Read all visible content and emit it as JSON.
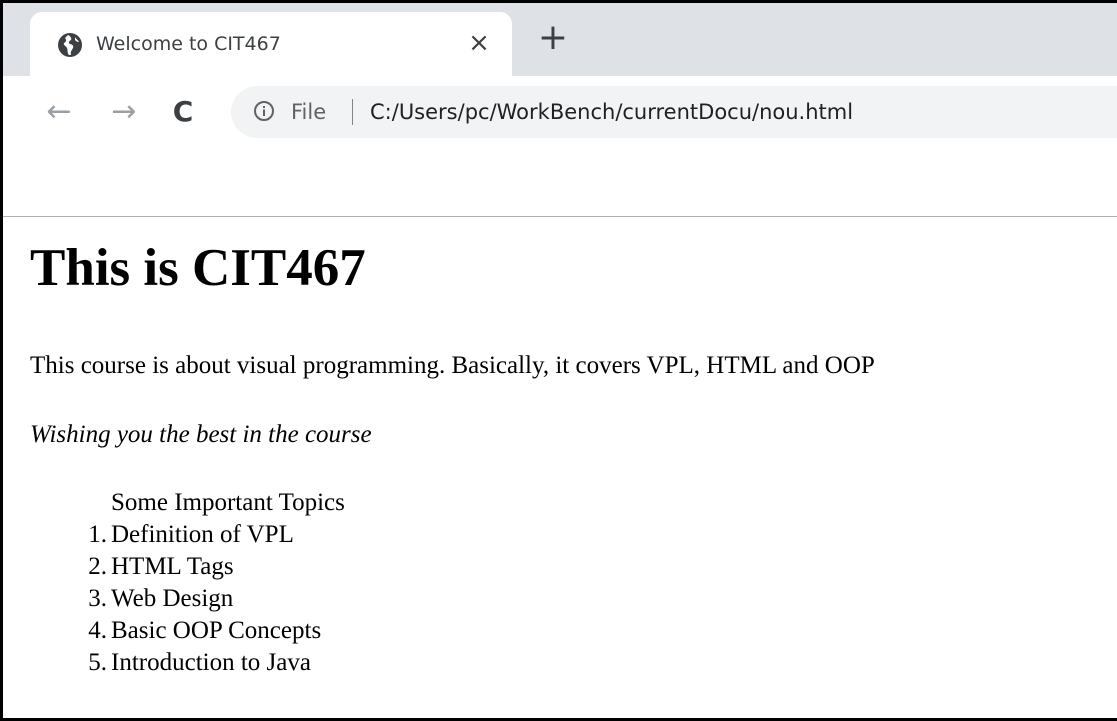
{
  "browser": {
    "tab": {
      "title": "Welcome to CIT467",
      "favicon": "globe-icon",
      "close_glyph": "×"
    },
    "new_tab_glyph": "+",
    "nav": {
      "back_glyph": "←",
      "forward_glyph": "→",
      "reload_glyph": "C"
    },
    "omnibox": {
      "scheme_label": "File",
      "url": "C:/Users/pc/WorkBench/currentDocu/nou.html",
      "info_icon": "info-icon"
    }
  },
  "page": {
    "heading": "This is CIT467",
    "intro": "This course is about visual programming. Basically, it covers VPL, HTML and OOP",
    "wish": "Wishing you the best in the course",
    "list_caption": "Some Important Topics",
    "topics": [
      {
        "num": "1.",
        "label": "Definition of VPL"
      },
      {
        "num": "2.",
        "label": "HTML Tags"
      },
      {
        "num": "3.",
        "label": "Web Design"
      },
      {
        "num": "4.",
        "label": "Basic OOP Concepts"
      },
      {
        "num": "5.",
        "label": "Introduction to Java"
      }
    ]
  },
  "colors": {
    "tabstrip": "#dee1e6",
    "omnibox": "#f1f3f4",
    "text": "#000000"
  }
}
